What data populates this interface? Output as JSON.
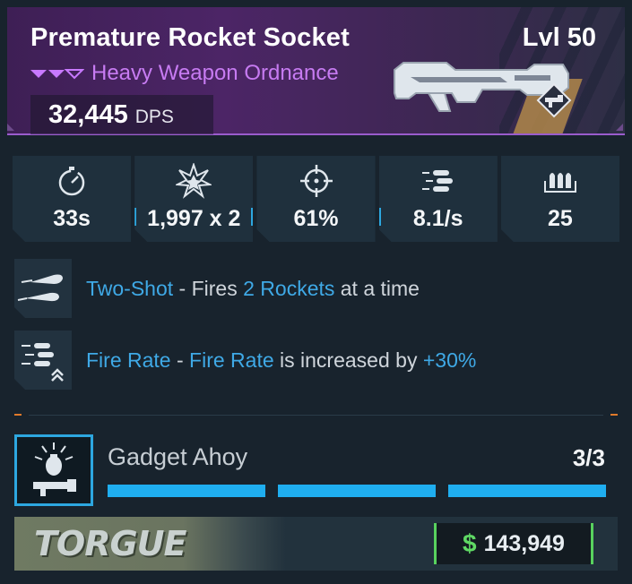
{
  "item": {
    "name": "Premature Rocket Socket",
    "level": "Lvl 50",
    "type": "Heavy Weapon Ordnance",
    "dps_value": "32,445",
    "dps_unit": "DPS",
    "rarity_color": "#c879ff",
    "weapon_icon": "rocket-launcher-icon",
    "badge_icon": "heavy-weapon-badge-icon"
  },
  "stats": [
    {
      "icon": "stopwatch-icon",
      "value": "33s"
    },
    {
      "icon": "explosion-icon",
      "value": "1,997 x 2"
    },
    {
      "icon": "crosshair-icon",
      "value": "61%"
    },
    {
      "icon": "fire-rate-bullets-icon",
      "value": "8.1/s"
    },
    {
      "icon": "magazine-ammo-icon",
      "value": "25"
    }
  ],
  "perks": [
    {
      "icon": "two-shot-rockets-icon",
      "parts": [
        "Two-Shot",
        " - Fires ",
        "2 Rockets",
        " at a time"
      ]
    },
    {
      "icon": "fire-rate-up-icon",
      "parts": [
        "Fire Rate",
        " - ",
        "Fire Rate",
        " is increased by ",
        "+30%"
      ]
    }
  ],
  "gadget": {
    "icon": "gadget-grenade-launcher-icon",
    "name": "Gadget Ahoy",
    "count": "3/3",
    "filled": 3,
    "total": 3,
    "bar_color": "#1faef0"
  },
  "footer": {
    "manufacturer": "TORGUE",
    "price_symbol": "$",
    "price": "143,949",
    "price_color": "#5fd964"
  }
}
